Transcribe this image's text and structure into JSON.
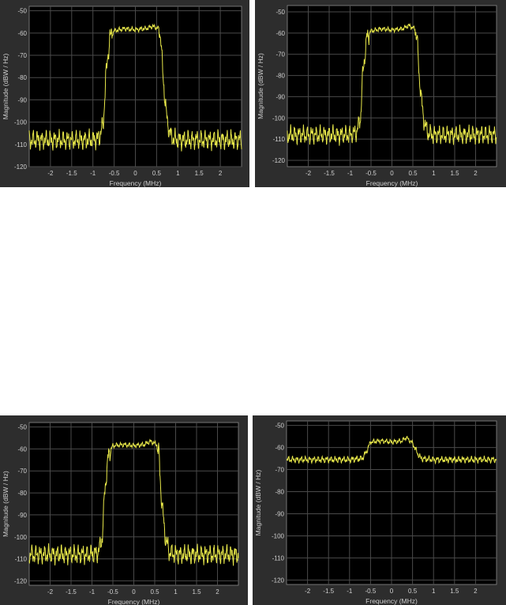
{
  "colors": {
    "trace": "#e8e84a",
    "axes_bg": "#000000",
    "figure_bg": "#2d2d2d",
    "grid": "#4a4a4a",
    "text": "#cfcfcf"
  },
  "chart_data": [
    {
      "type": "line",
      "xlabel": "Frequency (MHz)",
      "ylabel": "Magnitude (dBW / Hz)",
      "xlim": [
        -2.5,
        2.5
      ],
      "ylim": [
        -120,
        -48
      ],
      "xticks": [
        -2,
        -1.5,
        -1,
        -0.5,
        0,
        0.5,
        1,
        1.5,
        2
      ],
      "yticks": [
        -50,
        -60,
        -70,
        -80,
        -90,
        -100,
        -110,
        -120
      ],
      "grid": true,
      "series": [
        {
          "x": [
            -2.5,
            -2.0,
            -1.5,
            -1.0,
            -0.85,
            -0.75,
            -0.7,
            -0.6,
            -0.5,
            -0.25,
            0,
            0.25,
            0.4,
            0.55,
            0.6,
            0.65,
            0.75,
            0.85,
            1.0,
            1.5,
            2.0,
            2.5
          ],
          "y": [
            -108,
            -108,
            -108,
            -108,
            -107,
            -100,
            -80,
            -62,
            -59,
            -58,
            -58.5,
            -58,
            -57,
            -58,
            -62,
            -80,
            -100,
            -107,
            -108,
            -108,
            -108,
            -108
          ]
        }
      ]
    },
    {
      "type": "line",
      "xlabel": "Frequency (MHz)",
      "ylabel": "Magnitude (dBW / Hz)",
      "xlim": [
        -2.5,
        2.5
      ],
      "ylim": [
        -123,
        -47
      ],
      "xticks": [
        -2,
        -1.5,
        -1,
        -0.5,
        0,
        0.5,
        1,
        1.5,
        2
      ],
      "yticks": [
        -50,
        -60,
        -70,
        -80,
        -90,
        -100,
        -110,
        -120
      ],
      "grid": true,
      "series": [
        {
          "x": [
            -2.5,
            -2.0,
            -1.5,
            -1.0,
            -0.85,
            -0.75,
            -0.7,
            -0.6,
            -0.5,
            -0.25,
            0,
            0.25,
            0.4,
            0.55,
            0.6,
            0.65,
            0.75,
            0.85,
            1.0,
            1.5,
            2.0,
            2.5
          ],
          "y": [
            -108,
            -108,
            -108,
            -108,
            -107,
            -100,
            -80,
            -62,
            -59,
            -58,
            -58.5,
            -58,
            -56.5,
            -58,
            -62,
            -80,
            -100,
            -107,
            -108,
            -108,
            -108,
            -108
          ]
        }
      ]
    },
    {
      "type": "line",
      "xlabel": "Frequency (MHz)",
      "ylabel": "Magnitude (dBW / Hz)",
      "xlim": [
        -2.5,
        2.5
      ],
      "ylim": [
        -122,
        -48
      ],
      "xticks": [
        -2,
        -1.5,
        -1,
        -0.5,
        0,
        0.5,
        1,
        1.5,
        2
      ],
      "yticks": [
        -50,
        -60,
        -70,
        -80,
        -90,
        -100,
        -110,
        -120
      ],
      "grid": true,
      "series": [
        {
          "x": [
            -2.5,
            -2.0,
            -1.5,
            -1.0,
            -0.85,
            -0.75,
            -0.7,
            -0.6,
            -0.5,
            -0.25,
            0,
            0.25,
            0.4,
            0.55,
            0.6,
            0.65,
            0.75,
            0.85,
            1.0,
            1.5,
            2.0,
            2.5
          ],
          "y": [
            -108,
            -108,
            -108,
            -108,
            -107,
            -100,
            -80,
            -62,
            -58.5,
            -58,
            -58.5,
            -58,
            -56.5,
            -58,
            -62,
            -80,
            -100,
            -107,
            -108,
            -108,
            -108,
            -108
          ]
        }
      ]
    },
    {
      "type": "line",
      "xlabel": "Frequency (MHz)",
      "ylabel": "Magnitude (dBW / Hz)",
      "xlim": [
        -2.5,
        2.5
      ],
      "ylim": [
        -122,
        -48
      ],
      "xticks": [
        -2,
        -1.5,
        -1,
        -0.5,
        0,
        0.5,
        1,
        1.5,
        2
      ],
      "yticks": [
        -50,
        -60,
        -70,
        -80,
        -90,
        -100,
        -110,
        -120
      ],
      "grid": true,
      "series": [
        {
          "x": [
            -2.5,
            -2.0,
            -1.5,
            -1.0,
            -0.7,
            -0.6,
            -0.5,
            -0.25,
            0,
            0.25,
            0.35,
            0.5,
            0.6,
            0.7,
            1.0,
            1.5,
            2.0,
            2.5
          ],
          "y": [
            -65.5,
            -65.5,
            -65.5,
            -65.5,
            -65,
            -62,
            -57.5,
            -57,
            -57.5,
            -57,
            -55.5,
            -58,
            -62,
            -65,
            -65.5,
            -65.5,
            -65.5,
            -65.5
          ]
        }
      ]
    }
  ]
}
